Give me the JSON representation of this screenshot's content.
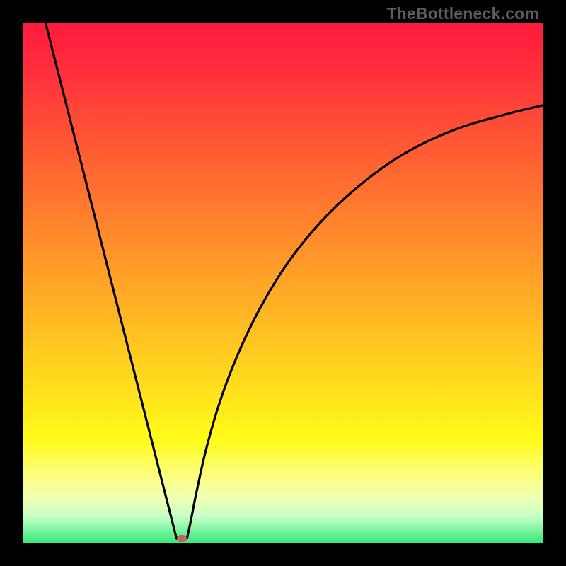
{
  "watermark": "TheBottleneck.com",
  "chart_data": {
    "type": "line",
    "title": "",
    "xlabel": "",
    "ylabel": "",
    "x_range_fraction": [
      0,
      1
    ],
    "y_range_fraction": [
      0,
      1
    ],
    "minimum_point_fraction": {
      "x": 0.305,
      "y": 0.992
    },
    "left_branch": {
      "start_fraction": {
        "x": 0.043,
        "y": 0.0
      },
      "end_fraction": {
        "x": 0.295,
        "y": 0.992
      }
    },
    "right_branch_fraction": [
      {
        "x": 0.315,
        "y": 0.992
      },
      {
        "x": 0.322,
        "y": 0.96
      },
      {
        "x": 0.334,
        "y": 0.9
      },
      {
        "x": 0.352,
        "y": 0.82
      },
      {
        "x": 0.378,
        "y": 0.73
      },
      {
        "x": 0.412,
        "y": 0.64
      },
      {
        "x": 0.455,
        "y": 0.55
      },
      {
        "x": 0.51,
        "y": 0.46
      },
      {
        "x": 0.575,
        "y": 0.38
      },
      {
        "x": 0.65,
        "y": 0.31
      },
      {
        "x": 0.735,
        "y": 0.25
      },
      {
        "x": 0.83,
        "y": 0.205
      },
      {
        "x": 0.93,
        "y": 0.175
      },
      {
        "x": 1.0,
        "y": 0.158
      }
    ],
    "gradient_meaning": "top red = high bottleneck, bottom green = low bottleneck",
    "marker_color": "#c06560"
  }
}
